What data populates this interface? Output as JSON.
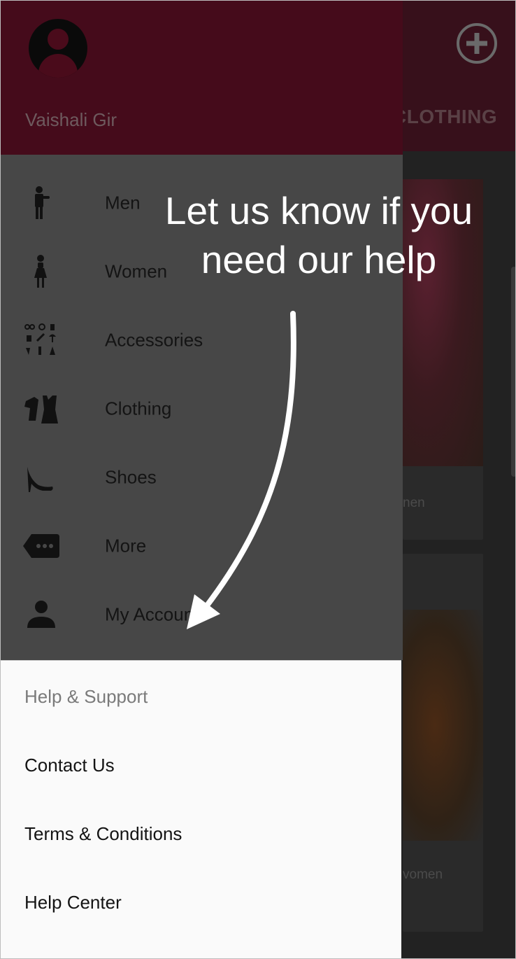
{
  "background": {
    "tab_label": "CLOTHING",
    "cards": [
      {
        "label": "nen"
      },
      {
        "label": "vomen"
      }
    ]
  },
  "drawer": {
    "user_name": "Vaishali Gir",
    "menu": [
      {
        "label": "Men",
        "icon": "man-icon"
      },
      {
        "label": "Women",
        "icon": "woman-icon"
      },
      {
        "label": "Accessories",
        "icon": "accessories-icon"
      },
      {
        "label": "Clothing",
        "icon": "clothing-icon"
      },
      {
        "label": "Shoes",
        "icon": "high-heel-icon"
      },
      {
        "label": "More",
        "icon": "more-tag-icon"
      },
      {
        "label": "My Account",
        "icon": "account-icon"
      }
    ],
    "help": {
      "heading": "Help & Support",
      "items": [
        "Contact Us",
        "Terms & Conditions",
        "Help Center"
      ]
    }
  },
  "tooltip": {
    "line1": "Let us know if you",
    "line2": "need our help"
  },
  "colors": {
    "brand": "#450b1b",
    "overlay_text": "#ffffff",
    "help_background": "#fafafa"
  }
}
